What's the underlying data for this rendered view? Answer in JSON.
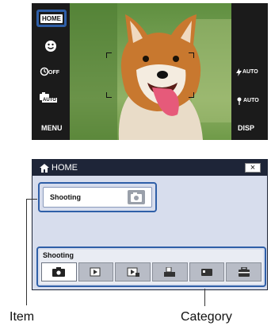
{
  "camera_screen": {
    "left_buttons": {
      "home": "HOME",
      "smile_icon": "smile-shutter-icon",
      "self_timer": "OFF",
      "scene": "AUTO",
      "menu": "MENU"
    },
    "right_buttons": {
      "flash": "AUTO",
      "macro": "AUTO",
      "disp": "DISP"
    }
  },
  "home_panel": {
    "title": "HOME",
    "close_label": "×",
    "item": {
      "label": "Shooting",
      "icon": "camera-icon"
    },
    "category": {
      "label": "Shooting",
      "tabs": [
        {
          "icon": "camera-icon",
          "selected": true
        },
        {
          "icon": "view-images-icon",
          "selected": false
        },
        {
          "icon": "view-images-2-icon",
          "selected": false
        },
        {
          "icon": "print-icon",
          "selected": false
        },
        {
          "icon": "memory-card-icon",
          "selected": false
        },
        {
          "icon": "settings-toolbox-icon",
          "selected": false
        }
      ]
    }
  },
  "callouts": {
    "item": "Item",
    "category": "Category"
  },
  "colors": {
    "highlight": "#2f5fa8",
    "header_bg": "#1e2538",
    "panel_bg": "#d7dded"
  }
}
